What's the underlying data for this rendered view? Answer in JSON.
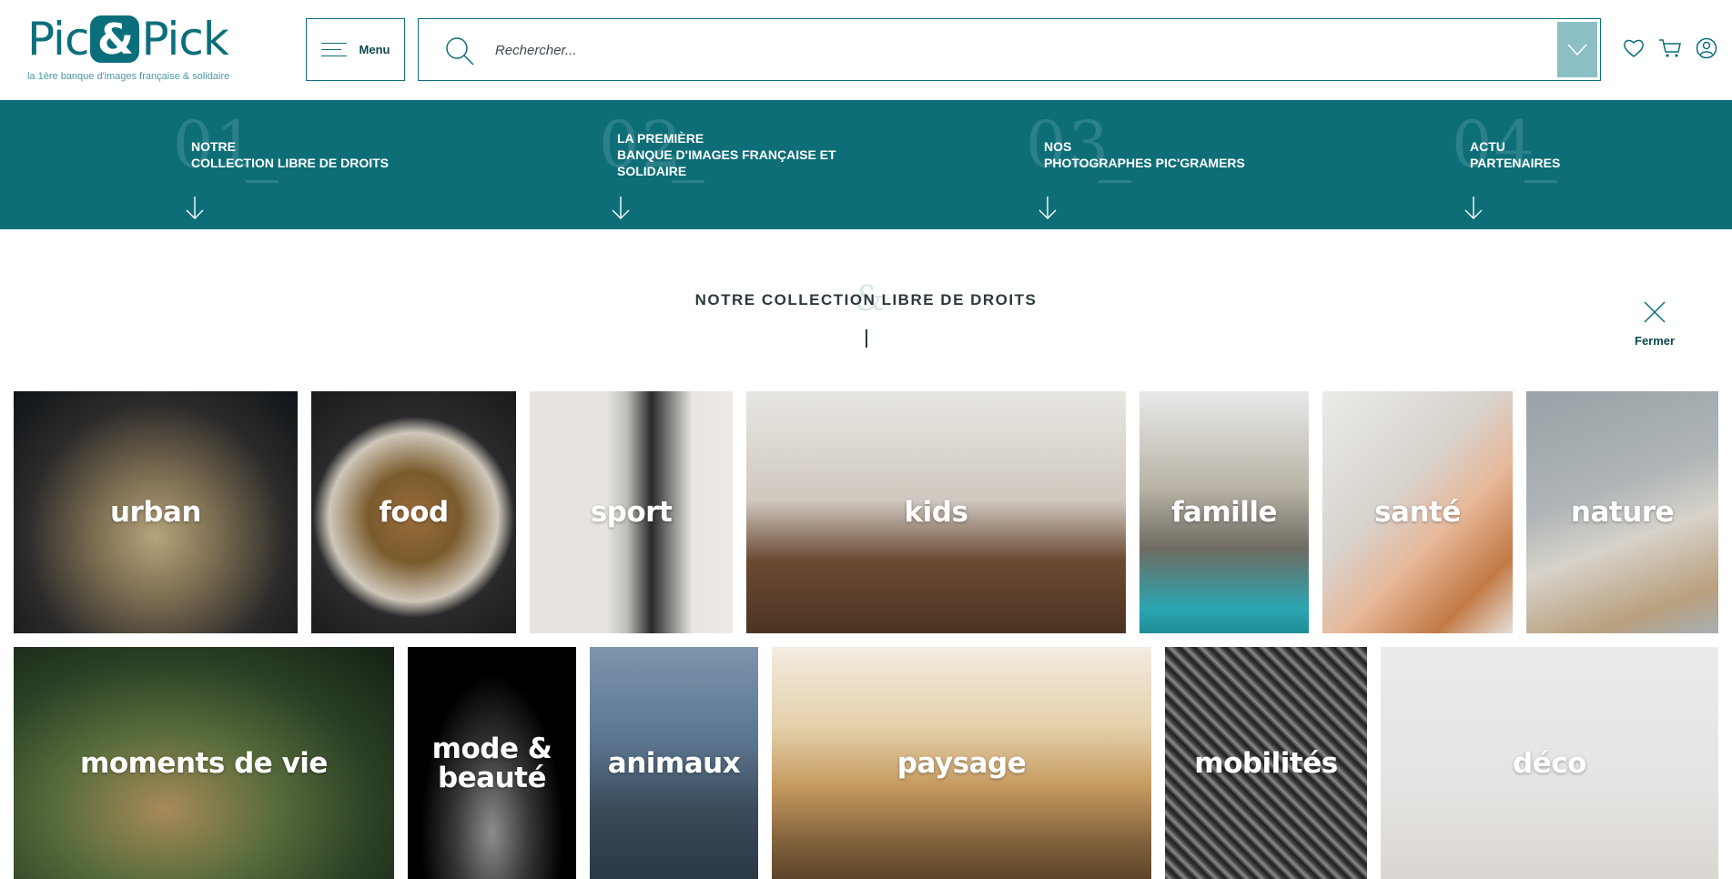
{
  "header": {
    "logo_left": "Pic",
    "logo_amp": "&",
    "logo_right": "Pick",
    "tagline": "la 1ère banque d'images française & solidaire",
    "menu_label": "Menu",
    "search_placeholder": "Rechercher..."
  },
  "icons": {
    "burger": "burger-icon",
    "search": "search-icon",
    "dropdown": "chevron-down-icon",
    "wishlist": "heart-icon",
    "cart": "cart-icon",
    "account": "user-icon",
    "close": "close-icon",
    "arrow": "arrow-down-icon"
  },
  "nav": {
    "items": [
      {
        "number": "01",
        "lines": [
          "NOTRE",
          "COLLECTION LIBRE DE DROITS"
        ]
      },
      {
        "number": "02",
        "lines": [
          "LA PREMIÈRE",
          "BANQUE D'IMAGES FRANÇAISE ET",
          "SOLIDAIRE"
        ]
      },
      {
        "number": "03",
        "lines": [
          "NOS",
          "PHOTOGRAPHES PIC'GRAMERS"
        ]
      },
      {
        "number": "04",
        "lines": [
          "ACTU",
          "PARTENAIRES"
        ]
      }
    ]
  },
  "section": {
    "title": "NOTRE COLLECTION LIBRE DE DROITS",
    "decor_amp": "&",
    "close_label": "Fermer"
  },
  "categories": {
    "urban": "urban",
    "food": "food",
    "sport": "sport",
    "kids": "kids",
    "famille": "famille",
    "sante": "santé",
    "nature": "nature",
    "moments": "moments de vie",
    "mode_line1": "mode &",
    "mode_line2": "beauté",
    "animaux": "animaux",
    "paysage": "paysage",
    "mobilites": "mobilités",
    "deco": "déco"
  },
  "colors": {
    "brand_teal": "#0d6e78",
    "accent_light": "#8bbfc4"
  }
}
